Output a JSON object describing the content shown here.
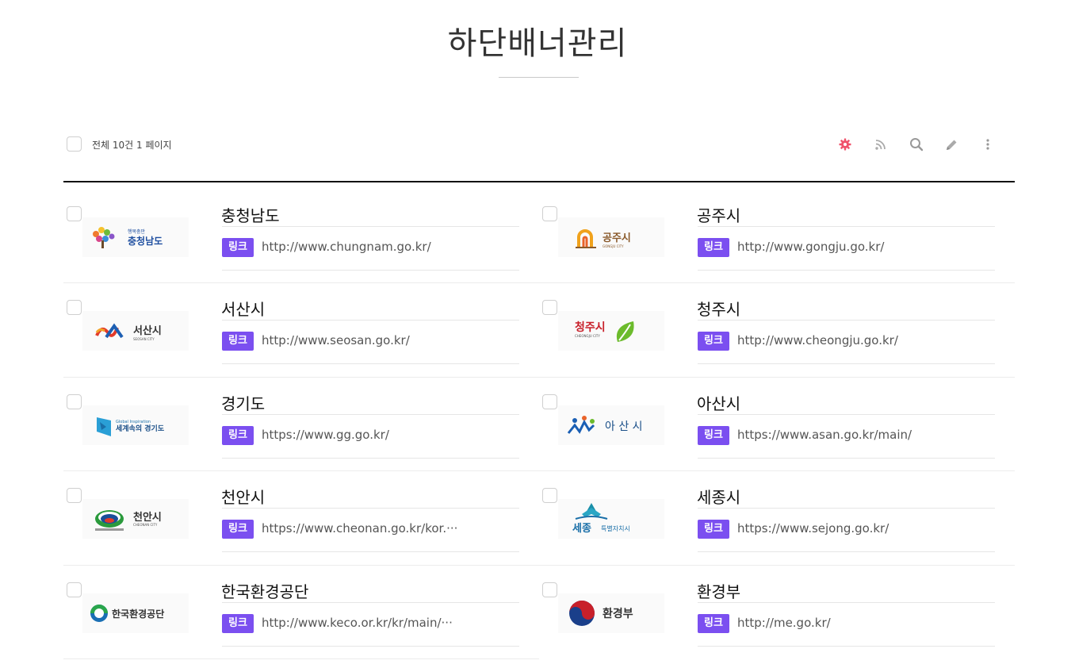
{
  "header": {
    "title": "하단배너관리"
  },
  "toolbar": {
    "count_text": "전체 10건 1 페이지",
    "icons": [
      "gear-icon",
      "rss-icon",
      "search-icon",
      "pencil-icon",
      "more-vertical-icon"
    ],
    "accent_color": "#f0526b"
  },
  "banner_badge_label": "링크",
  "banner_badge_color": "#7b4ff0",
  "banners": [
    {
      "title": "충청남도",
      "url": "http://www.chungnam.go.kr/",
      "logo_text": "충청남도",
      "logo_subtext": "행복충만"
    },
    {
      "title": "공주시",
      "url": "http://www.gongju.go.kr/",
      "logo_text": "공주시",
      "logo_subtext": "GONGJU CITY"
    },
    {
      "title": "서산시",
      "url": "http://www.seosan.go.kr/",
      "logo_text": "서산시",
      "logo_subtext": "SEOSAN CITY"
    },
    {
      "title": "청주시",
      "url": "http://www.cheongju.go.kr/",
      "logo_text": "청주시",
      "logo_subtext": "CHEONGJU CITY"
    },
    {
      "title": "경기도",
      "url": "https://www.gg.go.kr/",
      "logo_text": "세계속의 경기도",
      "logo_subtext": "Global Inspiration"
    },
    {
      "title": "아산시",
      "url": "https://www.asan.go.kr/main/",
      "logo_text": "아 산 시",
      "logo_subtext": ""
    },
    {
      "title": "천안시",
      "url": "https://www.cheonan.go.kr/kor.···",
      "logo_text": "천안시",
      "logo_subtext": "CHEONAN CITY"
    },
    {
      "title": "세종시",
      "url": "https://www.sejong.go.kr/",
      "logo_text": "세종",
      "logo_subtext": "특별자치시"
    },
    {
      "title": "한국환경공단",
      "url": "http://www.keco.or.kr/kr/main/···",
      "logo_text": "한국환경공단",
      "logo_subtext": ""
    },
    {
      "title": "환경부",
      "url": "http://me.go.kr/",
      "logo_text": "환경부",
      "logo_subtext": ""
    }
  ]
}
